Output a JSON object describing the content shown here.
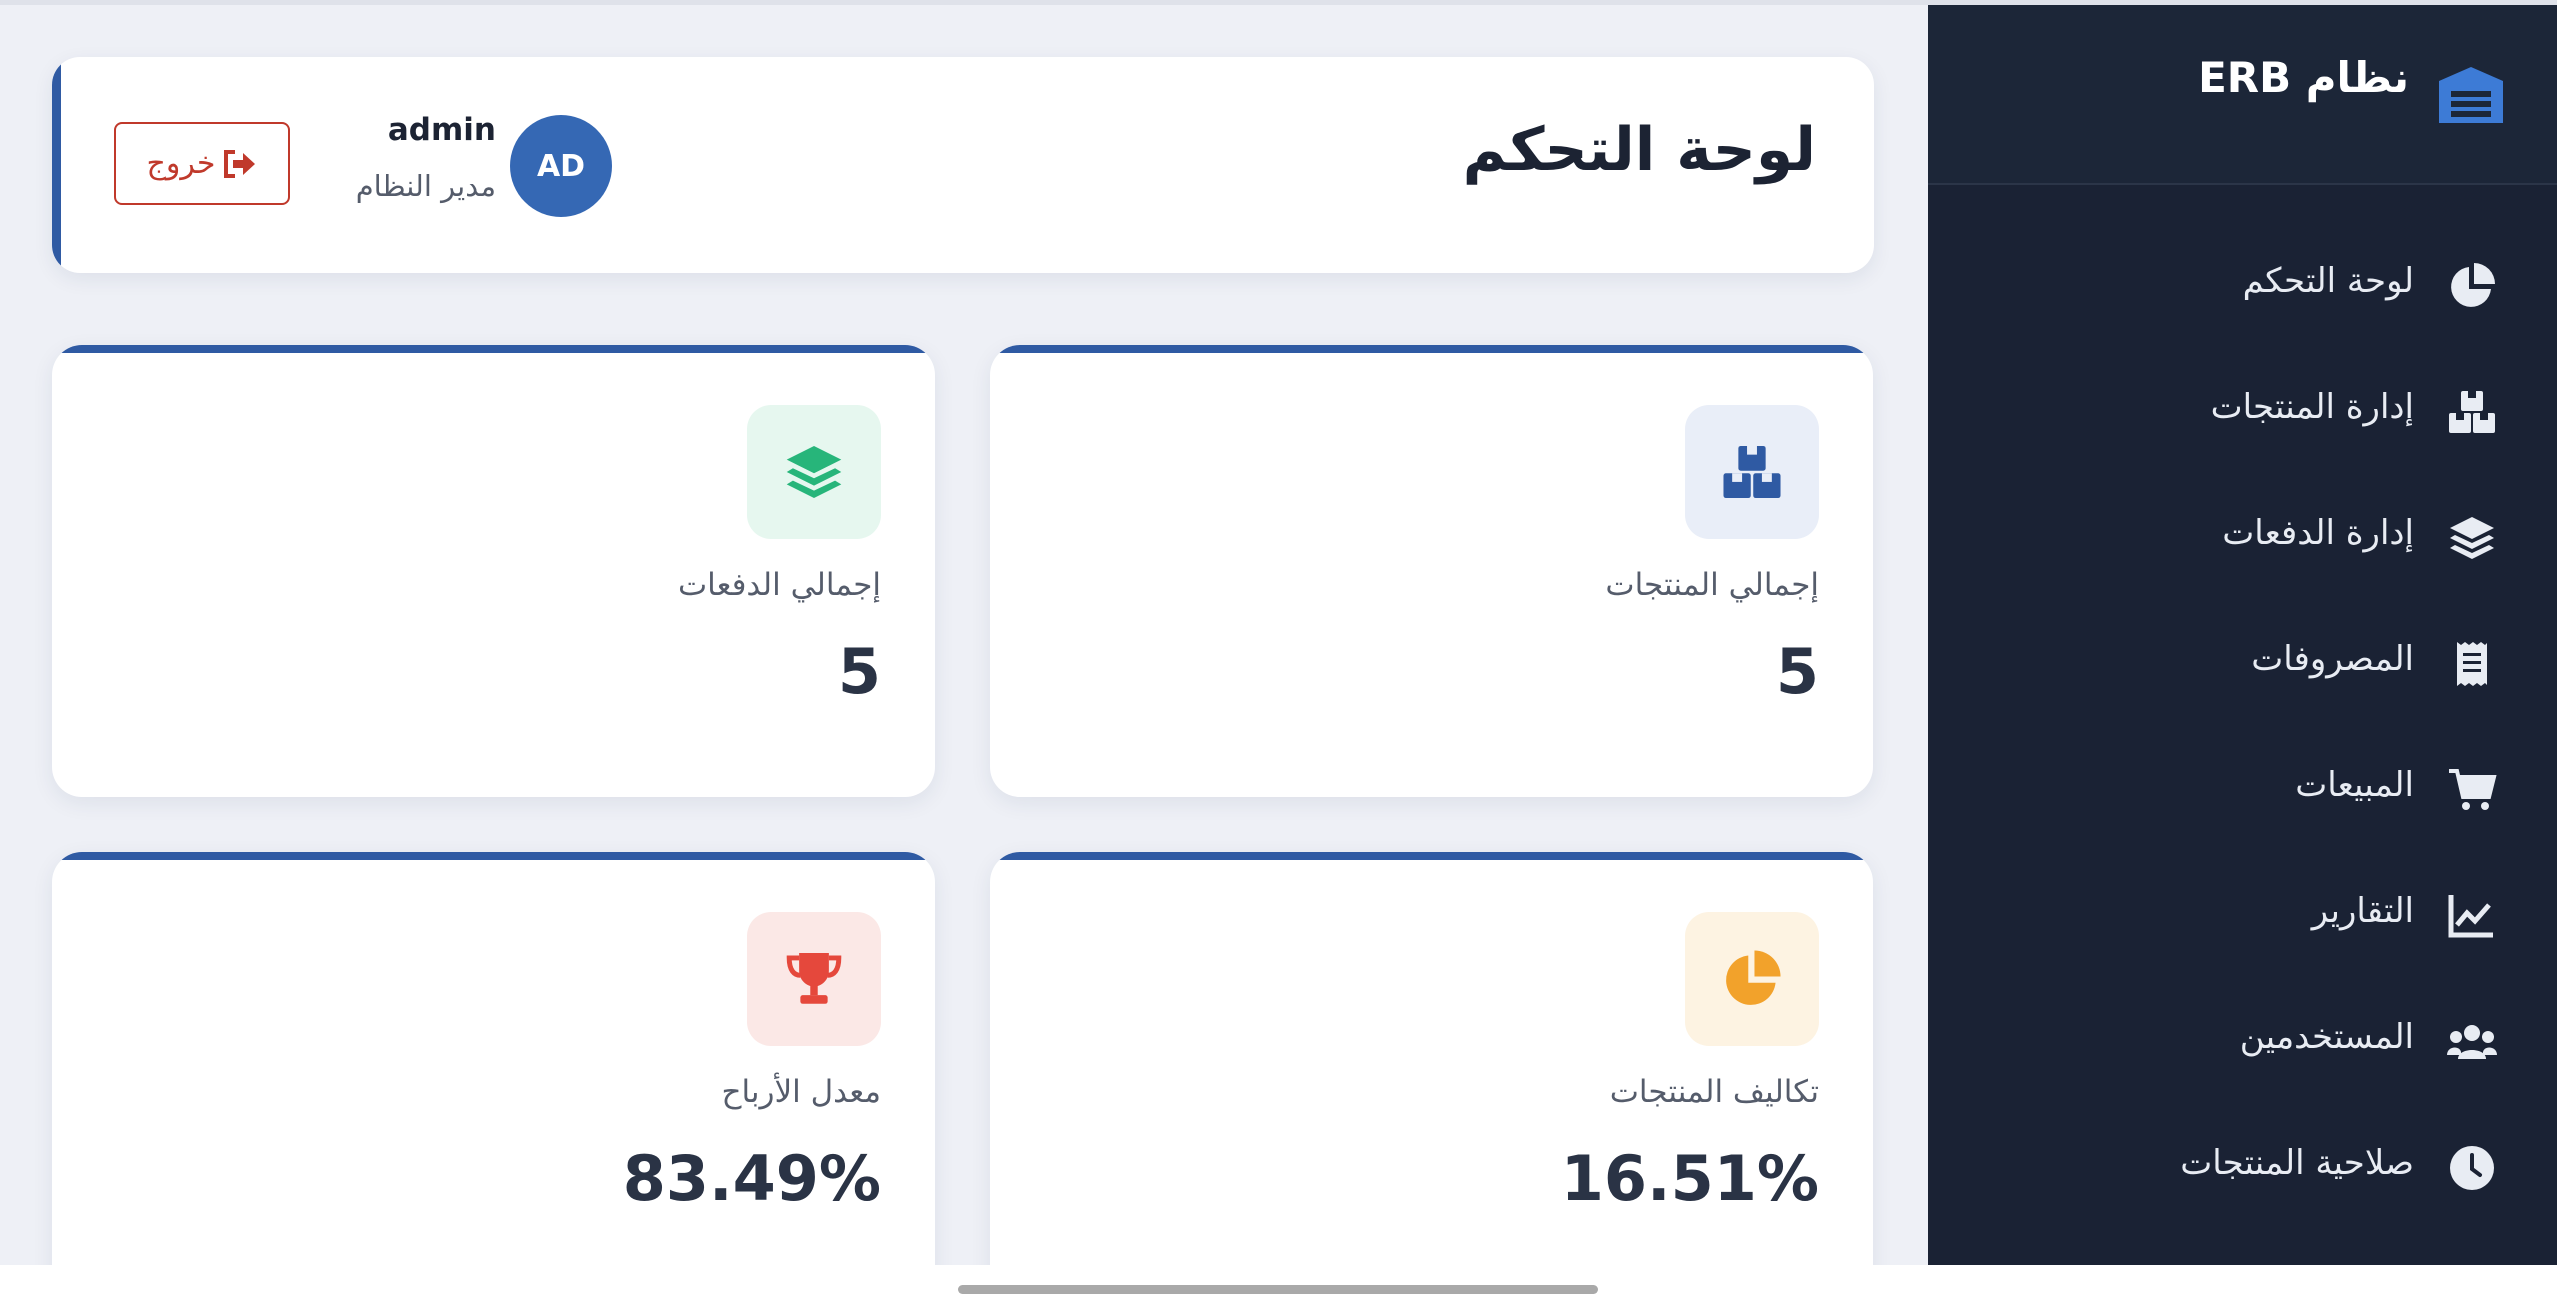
{
  "brand": {
    "title": "نظام ERB",
    "icon": "warehouse-icon"
  },
  "sidebar": {
    "items": [
      {
        "label": "لوحة التحكم",
        "icon": "chart-pie-icon"
      },
      {
        "label": "إدارة المنتجات",
        "icon": "boxes-icon"
      },
      {
        "label": "إدارة الدفعات",
        "icon": "layers-icon"
      },
      {
        "label": "المصروفات",
        "icon": "receipt-icon"
      },
      {
        "label": "المبيعات",
        "icon": "cart-icon"
      },
      {
        "label": "التقارير",
        "icon": "line-chart-icon"
      },
      {
        "label": "المستخدمين",
        "icon": "users-icon"
      },
      {
        "label": "صلاحية المنتجات",
        "icon": "clock-icon"
      }
    ]
  },
  "header": {
    "title": "لوحة التحكم",
    "user": {
      "initials": "AD",
      "name": "admin",
      "role": "مدير النظام"
    },
    "logout_label": "خروج"
  },
  "stats": [
    {
      "label": "إجمالي المنتجات",
      "value": "5",
      "icon": "boxes-icon",
      "color": "#2f5aa3",
      "bg": "#e9eef8"
    },
    {
      "label": "إجمالي الدفعات",
      "value": "5",
      "icon": "layers-icon",
      "color": "#27b57a",
      "bg": "#e6f7ef"
    },
    {
      "label": "تكاليف المنتجات",
      "value": "16.51%",
      "icon": "chart-pie-icon",
      "color": "#f2a22b",
      "bg": "#fdf3e2"
    },
    {
      "label": "معدل الأرباح",
      "value": "83.49%",
      "icon": "trophy-icon",
      "color": "#e5483c",
      "bg": "#fbe8e6"
    }
  ],
  "colors": {
    "sidebar": "#1a2234",
    "accent": "#2f5aa3",
    "logout": "#c0392b"
  }
}
